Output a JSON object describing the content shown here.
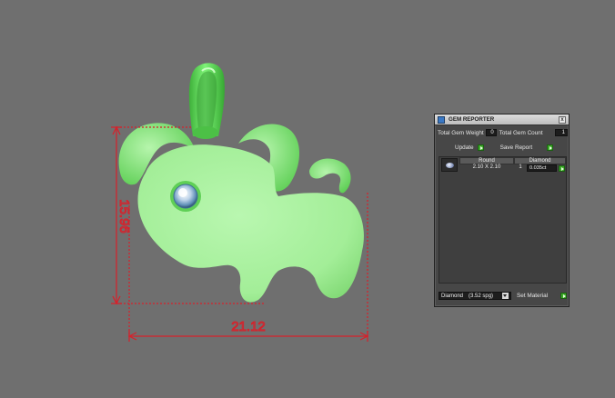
{
  "viewport": {
    "background": "#6f6f6f",
    "model_color": "#a6f29d",
    "handle_color": "#5ed95a",
    "dimension_color": "#d8202a",
    "dimensions": {
      "height_label": "15.96",
      "width_label": "21.12"
    }
  },
  "gem_reporter": {
    "title": "GEM REPORTER",
    "close_glyph": "x",
    "total_gem_weight_label": "Total Gem Weight",
    "total_gem_weight_value": "0",
    "total_gem_count_label": "Total Gem Count",
    "total_gem_count_value": "1",
    "update_label": "Update",
    "save_report_label": "Save Report",
    "table": {
      "columns": [
        "Round",
        "Diamond"
      ],
      "rows": [
        {
          "shape": "Round",
          "size": "2.10 X 2.10",
          "count": "1",
          "weight": "0.035ct"
        }
      ]
    },
    "material_select_value": "Diamond",
    "material_spg": "(3.52 spg)",
    "set_material_label": "Set Material",
    "accent_green": "#3caa28"
  }
}
